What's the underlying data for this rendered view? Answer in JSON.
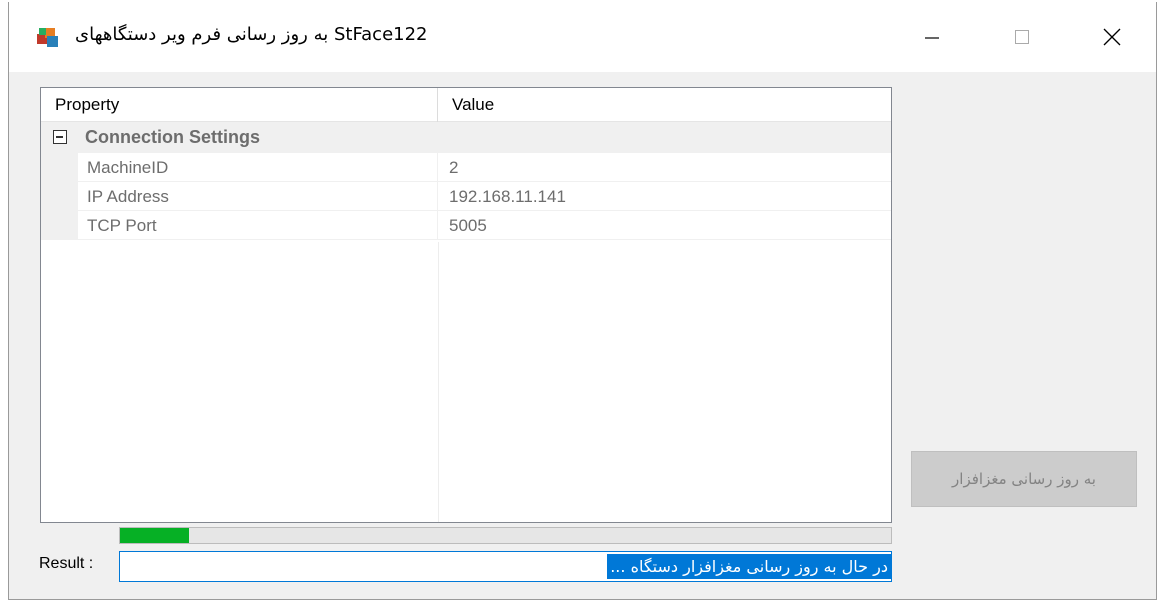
{
  "window": {
    "title": "به روز رسانی فرم ویر دستگاههای StFace122",
    "icon": "app-cube-icon",
    "controls": {
      "minimize": "minimize-icon",
      "maximize": "maximize-icon",
      "close": "close-icon"
    }
  },
  "property_grid": {
    "columns": [
      "Property",
      "Value"
    ],
    "category": {
      "label": "Connection Settings",
      "expanded": true
    },
    "rows": [
      {
        "name": "MachineID",
        "value": "2"
      },
      {
        "name": "IP Address",
        "value": "192.168.11.141"
      },
      {
        "name": "TCP Port",
        "value": "5005"
      }
    ]
  },
  "update_button": {
    "label": "به روز رسانی مغزافزار",
    "enabled": false
  },
  "progress": {
    "value": 0.09,
    "color": "#06b025"
  },
  "result": {
    "label": "Result :",
    "value": "در حال به روز رسانی مغزافزار دستگاه ..."
  },
  "colors": {
    "accent": "#0078d7",
    "window_bg": "#f0f0f0"
  }
}
